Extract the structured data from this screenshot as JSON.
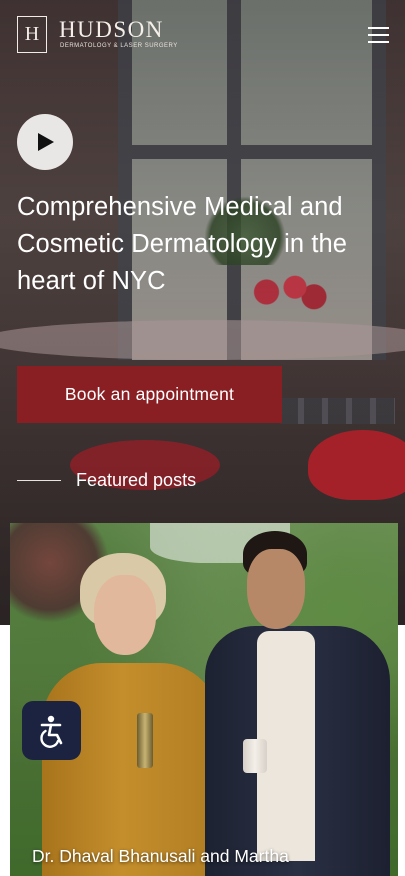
{
  "header": {
    "logo_letter": "H",
    "brand_name": "HUDSON",
    "brand_tagline": "DERMATOLOGY & LASER SURGERY",
    "menu_icon": "hamburger-menu-icon"
  },
  "hero": {
    "play_icon": "play-icon",
    "title": "Comprehensive Medical and Cosmetic Dermatology in the heart of NYC",
    "cta_label": "Book an appointment"
  },
  "featured": {
    "heading": "Featured posts",
    "post": {
      "caption": "Dr. Dhaval Bhanusali and Martha"
    }
  },
  "accessibility": {
    "icon": "accessibility-icon"
  },
  "colors": {
    "cta_background": "#8a1f23",
    "accessibility_background": "#1b2340",
    "text_on_dark": "#ffffff"
  }
}
